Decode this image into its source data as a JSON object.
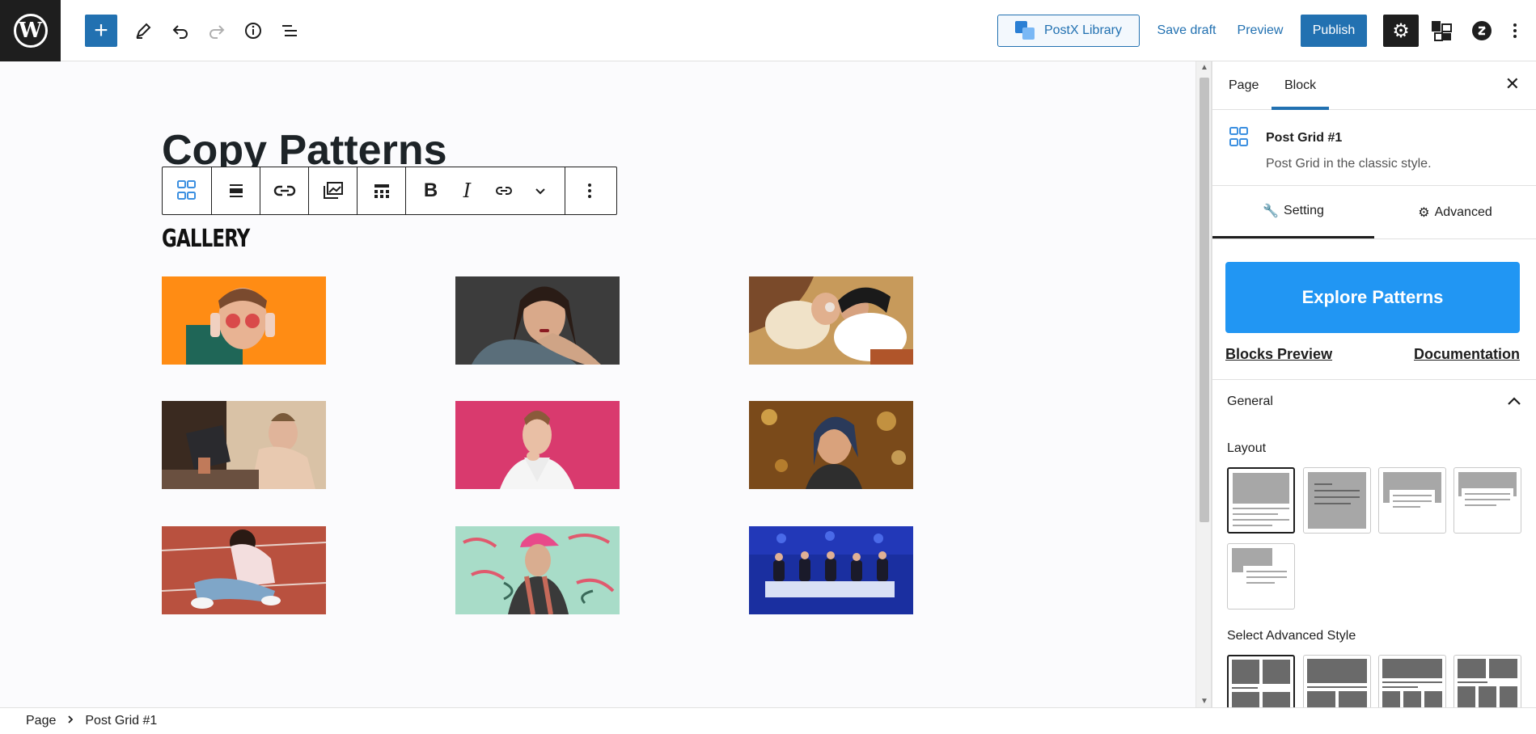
{
  "toolbar": {
    "postx_label": "PostX Library",
    "save_draft": "Save draft",
    "preview": "Preview",
    "publish": "Publish"
  },
  "editor": {
    "title": "Copy Patterns",
    "gallery_heading": "GALLERY",
    "block_toolbar": [
      "post-grid-icon",
      "align-icon",
      "link-chain-icon",
      "image-stack-icon",
      "table-layout-icon",
      "bold-icon",
      "italic-icon",
      "link-icon",
      "chevron-down-icon",
      "more-options-icon"
    ]
  },
  "sidebar": {
    "tabs": [
      "Page",
      "Block"
    ],
    "active_tab": "Block",
    "block_name": "Post Grid #1",
    "block_desc": "Post Grid in the classic style.",
    "sub_tabs": [
      "Setting",
      "Advanced"
    ],
    "explore_btn": "Explore Patterns",
    "link_preview": "Blocks Preview",
    "link_docs": "Documentation",
    "general": "General",
    "layout_label": "Layout",
    "advanced_style_label": "Select Advanced Style"
  },
  "footer": {
    "crumb_1": "Page",
    "crumb_2": "Post Grid #1"
  },
  "colors": {
    "accent": "#2271b1",
    "explore": "#2196f3",
    "dark": "#1e1e1e"
  }
}
